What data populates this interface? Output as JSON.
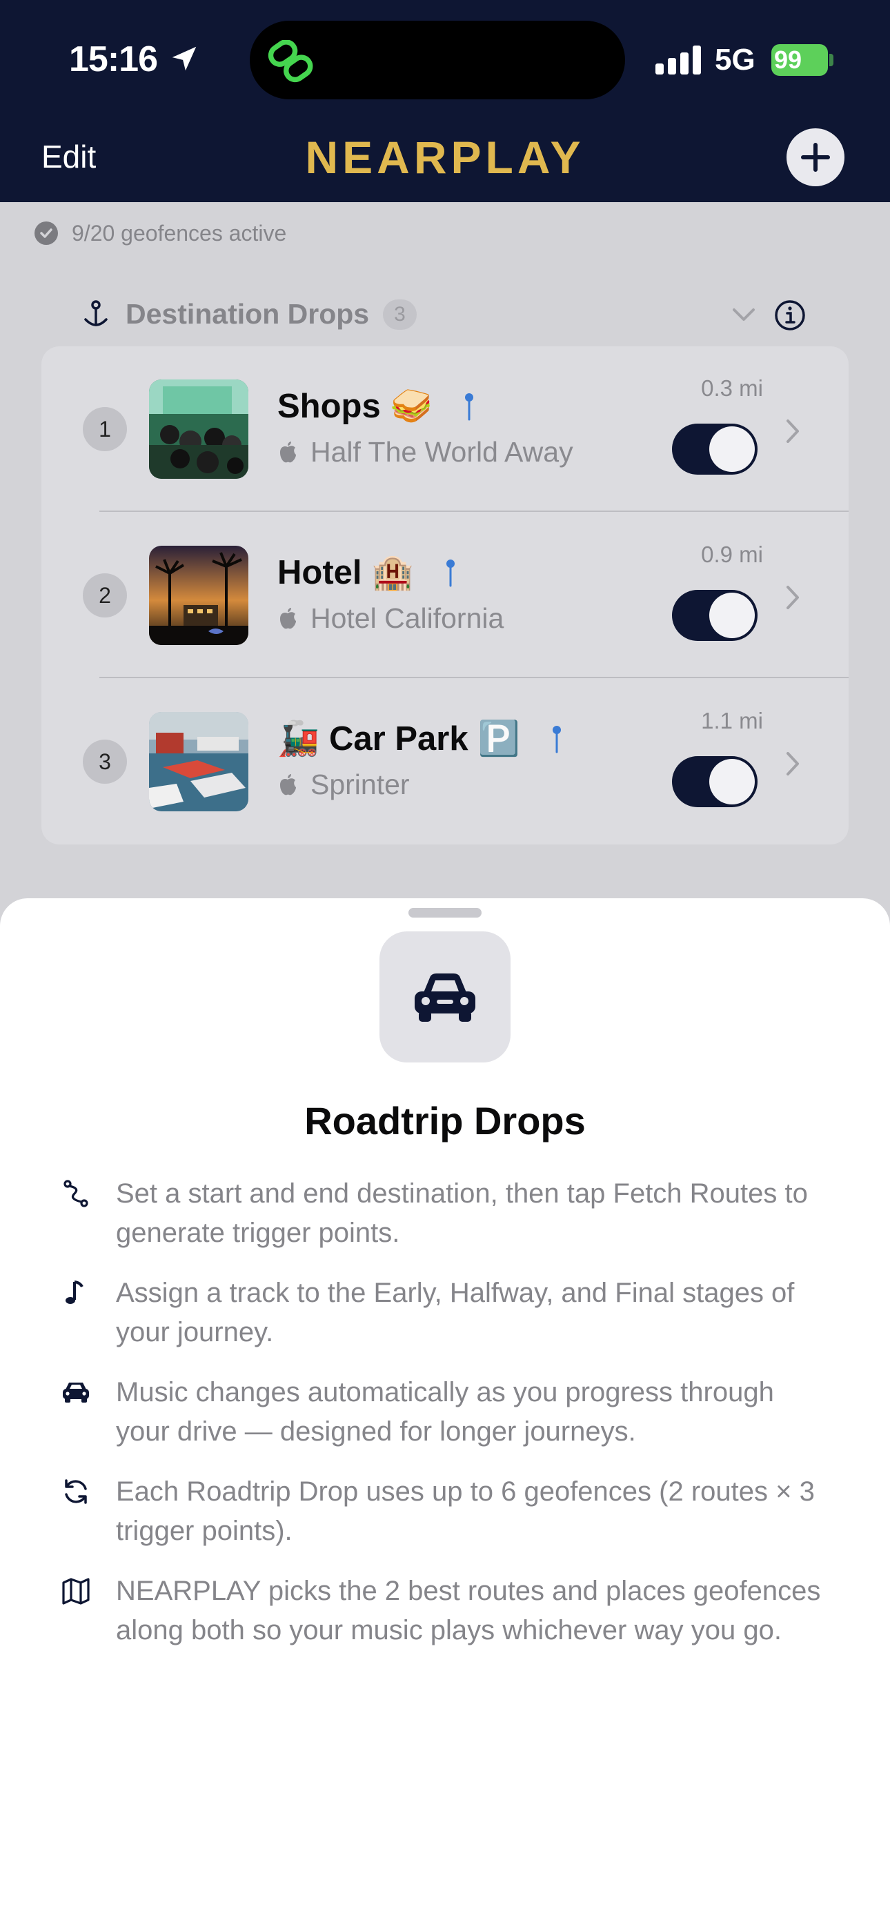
{
  "status_bar": {
    "time": "15:16",
    "network": "5G",
    "battery": "99"
  },
  "nav": {
    "edit_label": "Edit",
    "brand": "NEARPLAY",
    "add_label": "+"
  },
  "geofence_status": "9/20 geofences active",
  "section": {
    "title": "Destination Drops",
    "count": "3"
  },
  "drops": [
    {
      "index": "1",
      "title": "Shops",
      "emoji": "🥪",
      "track": "Half The World Away",
      "distance": "0.3 mi",
      "enabled": true
    },
    {
      "index": "2",
      "title": "Hotel",
      "emoji": "🏨",
      "track": "Hotel California",
      "distance": "0.9 mi",
      "enabled": true
    },
    {
      "index": "3",
      "title": "Car Park",
      "emoji_before": "🚂",
      "emoji_after": "🅿️",
      "track": "Sprinter",
      "distance": "1.1 mi",
      "enabled": true
    }
  ],
  "sheet": {
    "title": "Roadtrip Drops",
    "tips": [
      {
        "icon": "route-icon",
        "text": "Set a start and end destination, then tap Fetch Routes to generate trigger points."
      },
      {
        "icon": "music-note-icon",
        "text": "Assign a track to the Early, Halfway, and Final stages of your journey."
      },
      {
        "icon": "car-icon",
        "text": "Music changes automatically as you progress through your drive — designed for longer journeys."
      },
      {
        "icon": "refresh-icon",
        "text": "Each Roadtrip Drop uses up to 6 geofences (2 routes × 3 trigger points)."
      },
      {
        "icon": "map-icon",
        "text": "NEARPLAY picks the 2 best routes and places geofences along both so your music plays whichever way you go."
      }
    ]
  },
  "colors": {
    "navy": "#0e1633",
    "brand_gold": "#e0b84f",
    "battery_green": "#5dd05a",
    "pin_blue": "#3a7bd5"
  }
}
